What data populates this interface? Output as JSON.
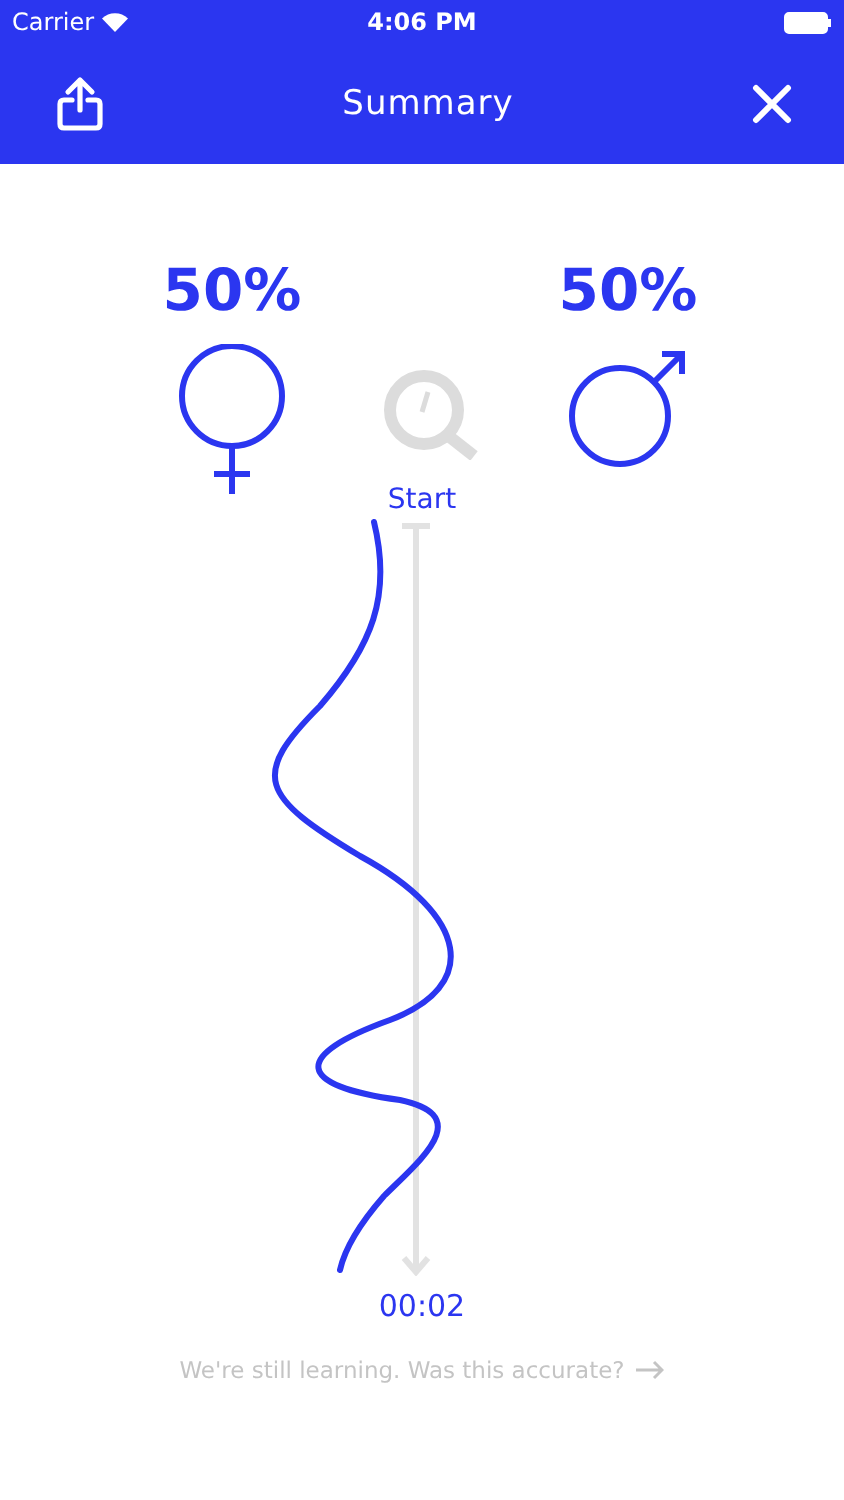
{
  "status_bar": {
    "carrier": "Carrier",
    "time": "4:06 PM"
  },
  "nav": {
    "title": "Summary"
  },
  "results": [
    {
      "kind": "female",
      "percent": "50%"
    },
    {
      "kind": "male",
      "percent": "50%"
    }
  ],
  "timeline": {
    "start_label": "Start",
    "end_label": "00:02"
  },
  "feedback": "We're still learning. Was this accurate?"
}
